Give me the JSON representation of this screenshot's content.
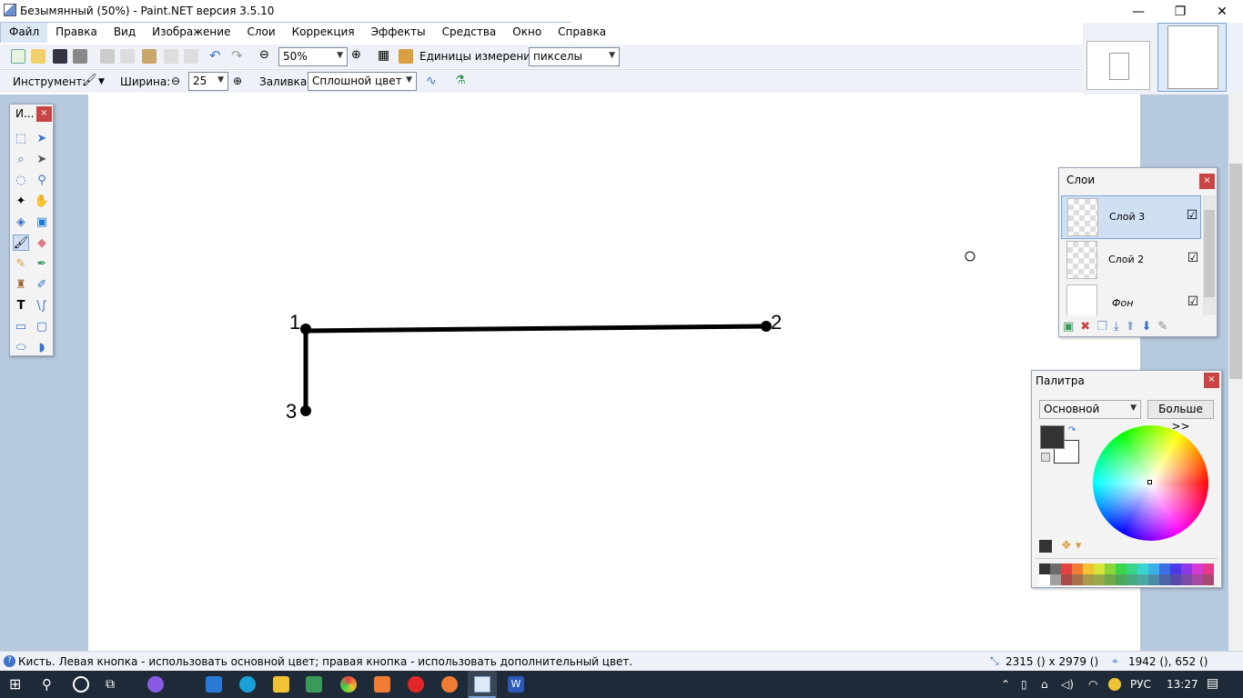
{
  "window": {
    "title": "Безымянный (50%) - Paint.NET версия 3.5.10",
    "minimize": "—",
    "restore": "❐",
    "close": "✕"
  },
  "menu": [
    "Файл",
    "Правка",
    "Вид",
    "Изображение",
    "Слои",
    "Коррекция",
    "Эффекты",
    "Средства",
    "Окно",
    "Справка"
  ],
  "toolbar": {
    "zoom_value": "50%",
    "units_label": "Единицы измерения:",
    "units_value": "пикселы",
    "tool_label": "Инструмент:",
    "width_label": "Ширина:",
    "width_value": "25",
    "fill_label": "Заливка:",
    "fill_value": "Сплошной цвет"
  },
  "toolbox": {
    "title": "И...",
    "close": "×",
    "tools": [
      "rectangle-select-icon",
      "move-selection-icon",
      "lasso-select-icon",
      "move-selected-icon",
      "ellipse-select-icon",
      "zoom-icon",
      "magic-wand-icon",
      "pan-icon",
      "paint-bucket-icon",
      "gradient-icon",
      "paintbrush-icon",
      "eraser-icon",
      "pencil-icon",
      "color-picker-icon",
      "clone-stamp-icon",
      "recolor-icon",
      "text-icon",
      "line-curve-icon",
      "rectangle-icon",
      "rounded-rectangle-icon",
      "ellipse-icon",
      "freeform-shape-icon"
    ]
  },
  "canvas": {
    "points": [
      "1",
      "2",
      "3"
    ]
  },
  "layers": {
    "title": "Слои",
    "close": "×",
    "items": [
      {
        "name": "Слой 3",
        "checked": "☑"
      },
      {
        "name": "Слой 2",
        "checked": "☑"
      },
      {
        "name": "Фон",
        "checked": "☑"
      }
    ]
  },
  "palette": {
    "title": "Палитра",
    "close": "×",
    "mode": "Основной",
    "more_button": "Больше >>",
    "primary_color": "#333333",
    "secondary_color": "#ffffff"
  },
  "status": {
    "hint": "Кисть. Левая кнопка - использовать основной цвет; правая кнопка - использовать дополнительный цвет.",
    "image_size": "2315 () x 2979 ()",
    "cursor_pos": "1942 (), 652 ()"
  },
  "taskbar": {
    "lang": "РУС",
    "time": "13:27"
  },
  "colors": {
    "accent": "#3b73c8",
    "workspace": "#b7c9de",
    "stroke": "#000000"
  }
}
